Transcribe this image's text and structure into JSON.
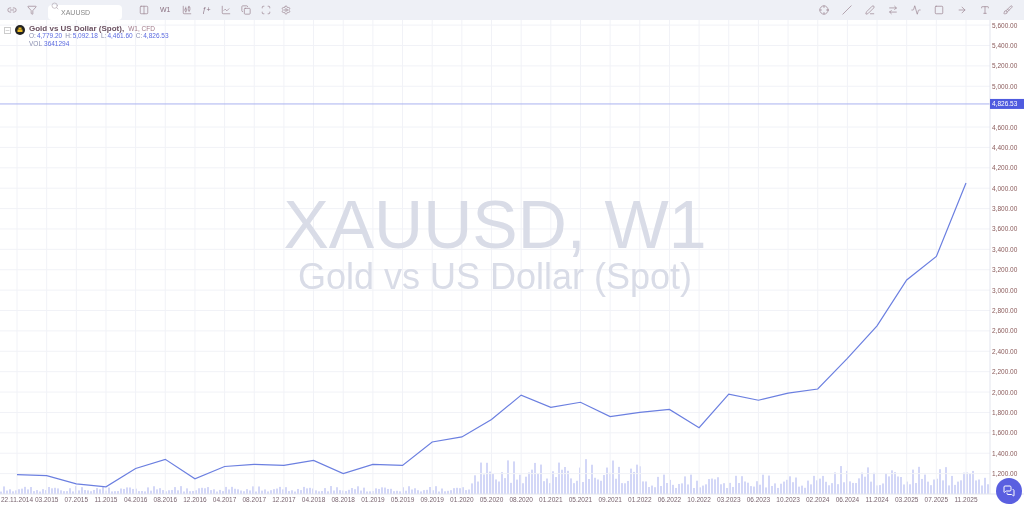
{
  "toolbar": {
    "search": {
      "value": "XAUUSD"
    },
    "timeframe": "W1",
    "indicators": "ƒ+"
  },
  "legend": {
    "title": "Gold vs US Dollar (Spot),",
    "subtitle": "W1, CFD",
    "ohlc": [
      {
        "label": "O:",
        "value": "4,779.20"
      },
      {
        "label": "H:",
        "value": "5,092.18"
      },
      {
        "label": "L:",
        "value": "4,461.60"
      },
      {
        "label": "C:",
        "value": "4,826.53"
      }
    ],
    "volume": {
      "label": "VOL",
      "value": "3641294"
    }
  },
  "watermark": {
    "title": "XAUUSD, W1",
    "subtitle": "Gold vs US Dollar (Spot)"
  },
  "chart_data": {
    "type": "line",
    "grid": true,
    "ylim": [
      1000,
      5650
    ],
    "ref_lines": [
      {
        "axis": "y",
        "value": 4826.53,
        "label": "4,826.53"
      }
    ],
    "categories": [
      "22.11.2014",
      "03.2015",
      "07.2015",
      "11.2015",
      "04.2016",
      "08.2016",
      "12.2016",
      "04.2017",
      "08.2017",
      "12.2017",
      "04.2018",
      "08.2018",
      "01.2019",
      "05.2019",
      "09.2019",
      "01.2020",
      "05.2020",
      "08.2020",
      "01.2021",
      "05.2021",
      "09.2021",
      "01.2022",
      "06.2022",
      "10.2022",
      "03.2023",
      "06.2023",
      "10.2023",
      "02.2024",
      "06.2024",
      "11.2024",
      "03.2025",
      "07.2025",
      "11.2025"
    ],
    "series": [
      {
        "color": "#6b7fe0",
        "values": [
          1190,
          1180,
          1100,
          1070,
          1250,
          1340,
          1150,
          1270,
          1290,
          1280,
          1330,
          1200,
          1290,
          1280,
          1510,
          1560,
          1730,
          1970,
          1850,
          1900,
          1760,
          1800,
          1830,
          1650,
          1980,
          1920,
          1990,
          2030,
          2330,
          2650,
          3100,
          3330,
          4050
        ]
      }
    ],
    "yticks": [
      {
        "value": 5600,
        "label": "5,600.00"
      },
      {
        "value": 5400,
        "label": "5,400.00"
      },
      {
        "value": 5200,
        "label": "5,200.00"
      },
      {
        "value": 5000,
        "label": "5,000.00"
      },
      {
        "value": 4600,
        "label": "4,600.00"
      },
      {
        "value": 4400,
        "label": "4,400.00"
      },
      {
        "value": 4200,
        "label": "4,200.00"
      },
      {
        "value": 4000,
        "label": "4,000.00"
      },
      {
        "value": 3800,
        "label": "3,800.00"
      },
      {
        "value": 3600,
        "label": "3,600.00"
      },
      {
        "value": 3400,
        "label": "3,400.00"
      },
      {
        "value": 3200,
        "label": "3,200.00"
      },
      {
        "value": 3000,
        "label": "3,000.00"
      },
      {
        "value": 2800,
        "label": "2,800.00"
      },
      {
        "value": 2600,
        "label": "2,600.00"
      },
      {
        "value": 2400,
        "label": "2,400.00"
      },
      {
        "value": 2200,
        "label": "2,200.00"
      },
      {
        "value": 2000,
        "label": "2,000.00"
      },
      {
        "value": 1800,
        "label": "1,800.00"
      },
      {
        "value": 1600,
        "label": "1,600.00"
      },
      {
        "value": 1400,
        "label": "1,400.00"
      },
      {
        "value": 1200,
        "label": "1,200.00"
      }
    ]
  }
}
